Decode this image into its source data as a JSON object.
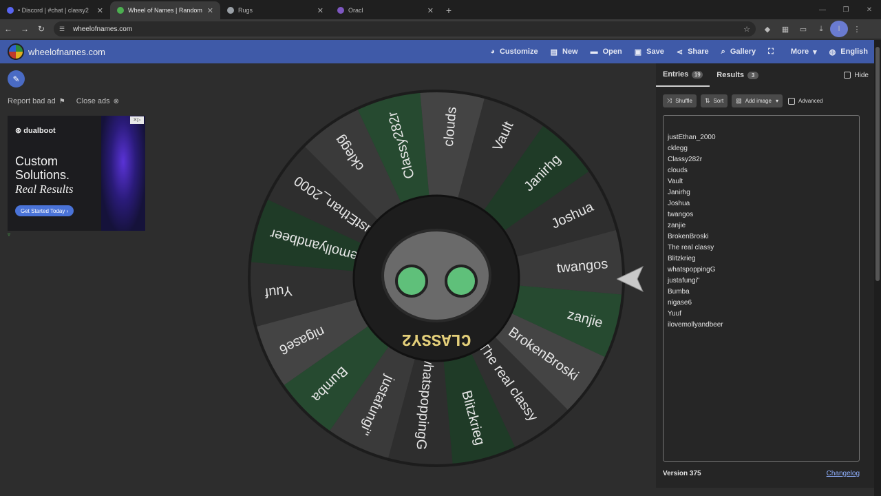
{
  "browser": {
    "tabs": [
      {
        "title": "• Discord | #chat | classy2",
        "favicon_color": "#5865f2",
        "active": false
      },
      {
        "title": "Wheel of Names | Random nam",
        "favicon_color": "#4caf50",
        "active": true
      },
      {
        "title": "Rugs",
        "favicon_color": "#9aa0a6",
        "active": false
      },
      {
        "title": "Oracl",
        "favicon_color": "#7e57c2",
        "active": false
      }
    ],
    "new_tab_icon": "plus-icon",
    "url": "wheelofnames.com",
    "profile_initial": "I"
  },
  "header": {
    "brand": "wheelofnames.com",
    "menu": [
      {
        "label": "Customize",
        "icon": "palette-icon",
        "glyph": "◕"
      },
      {
        "label": "New",
        "icon": "file-icon",
        "glyph": "▤"
      },
      {
        "label": "Open",
        "icon": "folder-icon",
        "glyph": "▬"
      },
      {
        "label": "Save",
        "icon": "save-icon",
        "glyph": "▣"
      },
      {
        "label": "Share",
        "icon": "share-icon",
        "glyph": "⋖"
      },
      {
        "label": "Gallery",
        "icon": "search-icon",
        "glyph": "⌕"
      },
      {
        "label": "",
        "icon": "fullscreen-icon",
        "glyph": "⛶"
      },
      {
        "label": "More",
        "icon": "chevron-down-icon",
        "glyph": "▾"
      },
      {
        "label": "English",
        "icon": "globe-icon",
        "glyph": "◍"
      }
    ]
  },
  "left": {
    "report_label": "Report bad ad",
    "close_ads_label": "Close ads",
    "ad": {
      "brand": "dualboot",
      "headline_line1": "Custom",
      "headline_line2": "Solutions.",
      "headline_italic": "Real Results",
      "cta": "Get Started Today"
    }
  },
  "panel": {
    "tabs": [
      {
        "label": "Entries",
        "count": "19",
        "active": true
      },
      {
        "label": "Results",
        "count": "3",
        "active": false
      }
    ],
    "hide_label": "Hide",
    "toolbar": {
      "shuffle": "Shuffle",
      "sort": "Sort",
      "add_image": "Add image",
      "advanced": "Advanced"
    },
    "entries": [
      "justEthan_2000",
      "cklegg",
      "Classy282r",
      "clouds",
      "Vault",
      "Janirhg",
      "Joshua",
      "twangos",
      "zanjie",
      "BrokenBroski",
      "The real classy",
      "Blitzkrieg",
      "whatspoppingG",
      "justafungi\"",
      "Bumba",
      "nigase6",
      "Yuuf",
      "ilovemollyandbeer"
    ],
    "version": "Version 375",
    "changelog": "Changelog"
  },
  "wheel": {
    "segment_colors": [
      "#2e2e2e",
      "#3a3a3a",
      "#264a30",
      "#444",
      "#303030",
      "#1f3b27"
    ],
    "labels": [
      "justEthan_2000",
      "cklegg",
      "Classy282r",
      "clouds",
      "Vault",
      "Janirhg",
      "Joshua",
      "twangos",
      "zanjie",
      "BrokenBroski",
      "The real classy",
      "Blitzkrieg",
      "whatspoppingG",
      "justafungi\"",
      "Bumba",
      "nigase6",
      "Yuuf",
      "ilovemollyandbeer"
    ],
    "center_text": "CLASSY2"
  }
}
